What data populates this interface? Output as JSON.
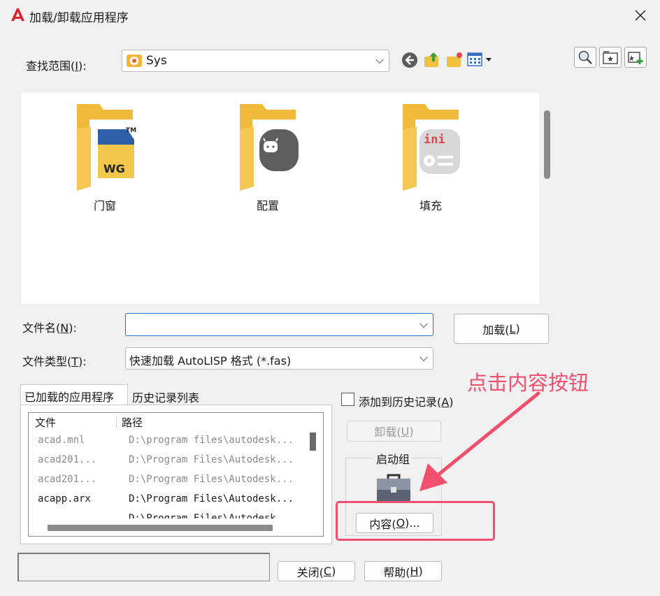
{
  "title": "加载/卸载应用程序",
  "lookin": {
    "label": "查找范围(I):",
    "label_pre": "查找范围(",
    "label_key": "I",
    "label_post": "):",
    "value": "Sys"
  },
  "files": [
    {
      "name": "门窗"
    },
    {
      "name": "配置"
    },
    {
      "name": "填充"
    }
  ],
  "filename": {
    "label_pre": "文件名(",
    "label_key": "N",
    "label_post": "):",
    "value": ""
  },
  "filetype": {
    "label_pre": "文件类型(",
    "label_key": "T",
    "label_post": "):",
    "value": "快速加载 AutoLISP 格式 (*.fas)"
  },
  "load_button": {
    "pre": "加载(",
    "key": "L",
    "post": ")"
  },
  "tabs": {
    "loaded": "已加载的应用程序",
    "history": "历史记录列表"
  },
  "table": {
    "columns": [
      "文件",
      "路径"
    ],
    "rows": [
      {
        "file": "acad.mnl",
        "path": "D:\\program files\\autodesk...",
        "dim": true
      },
      {
        "file": "acad201...",
        "path": "D:\\Program Files\\Autodesk...",
        "dim": true
      },
      {
        "file": "acad201...",
        "path": "D:\\Program Files\\Autodesk...",
        "dim": true
      },
      {
        "file": "acapp.arx",
        "path": "D:\\Program Files\\Autodesk...",
        "dim": false
      },
      {
        "file": "",
        "path": "D:\\Program Files\\Autodesk...",
        "dim": false
      }
    ]
  },
  "history_checkbox": {
    "pre": "添加到历史记录(",
    "key": "A",
    "post": ")"
  },
  "unload_button": {
    "pre": "卸载(",
    "key": "U",
    "post": ")"
  },
  "startup_group": {
    "label": "启动组"
  },
  "contents_button": {
    "pre": "内容(",
    "key": "O",
    "post": ")..."
  },
  "close_button": {
    "pre": "关闭(",
    "key": "C",
    "post": ")"
  },
  "help_button": {
    "pre": "帮助(",
    "key": "H",
    "post": ")"
  },
  "annotation": {
    "text": "点击内容按钮",
    "color": "#f0506e"
  }
}
